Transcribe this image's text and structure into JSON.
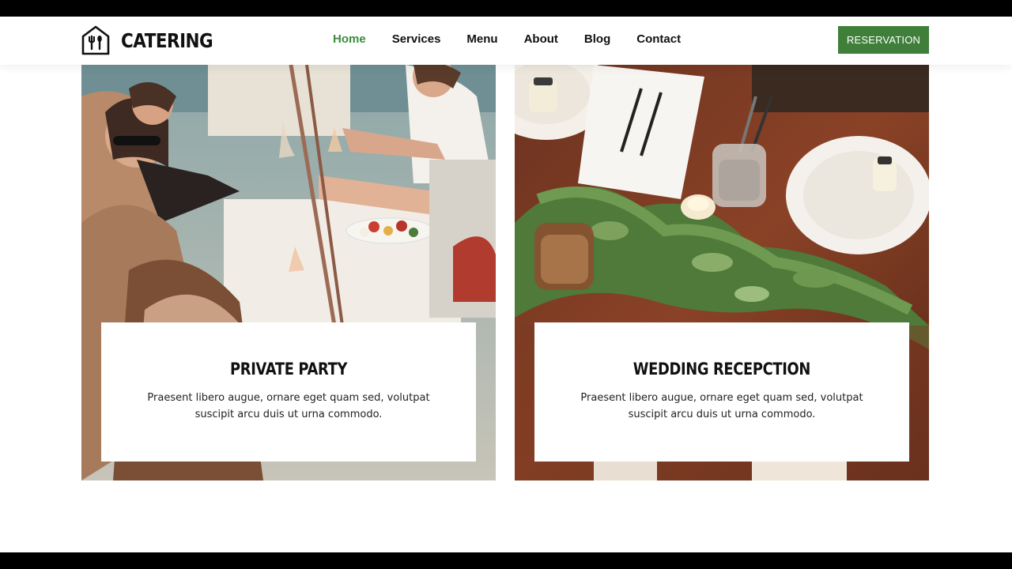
{
  "brand": {
    "name": "CATERING",
    "logo_icon": "house-fork-spoon-icon"
  },
  "nav": {
    "items": [
      {
        "label": "Home",
        "active": true
      },
      {
        "label": "Services",
        "active": false
      },
      {
        "label": "Menu",
        "active": false
      },
      {
        "label": "About",
        "active": false
      },
      {
        "label": "Blog",
        "active": false
      },
      {
        "label": "Contact",
        "active": false
      }
    ],
    "active_color": "#3d8b3d"
  },
  "reservation_button": {
    "label": "RESERVATION",
    "color": "#3f7f3a"
  },
  "cards": [
    {
      "title": "PRIVATE PARTY",
      "description": "Praesent libero augue, ornare eget quam sed, volutpat suscipit arcu duis ut urna commodo.",
      "image": "friends-toasting-on-boat-photo"
    },
    {
      "title": "WEDDING RECEPCTION",
      "description": "Praesent libero augue, ornare eget quam sed, volutpat suscipit arcu duis ut urna commodo.",
      "image": "wedding-table-setting-photo"
    }
  ]
}
